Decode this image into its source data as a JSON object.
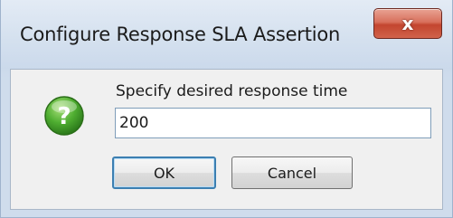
{
  "window": {
    "title": "Configure Response SLA Assertion",
    "close_glyph": "x",
    "close_icon": "close-icon"
  },
  "dialog": {
    "icon": "question-icon",
    "icon_glyph": "?",
    "prompt": "Specify desired response time",
    "input_value": "200",
    "ok_label": "OK",
    "cancel_label": "Cancel"
  },
  "colors": {
    "close_button": "#c9533d",
    "question_icon": "#3f9a2a",
    "default_button_border": "#3c7fb1"
  }
}
